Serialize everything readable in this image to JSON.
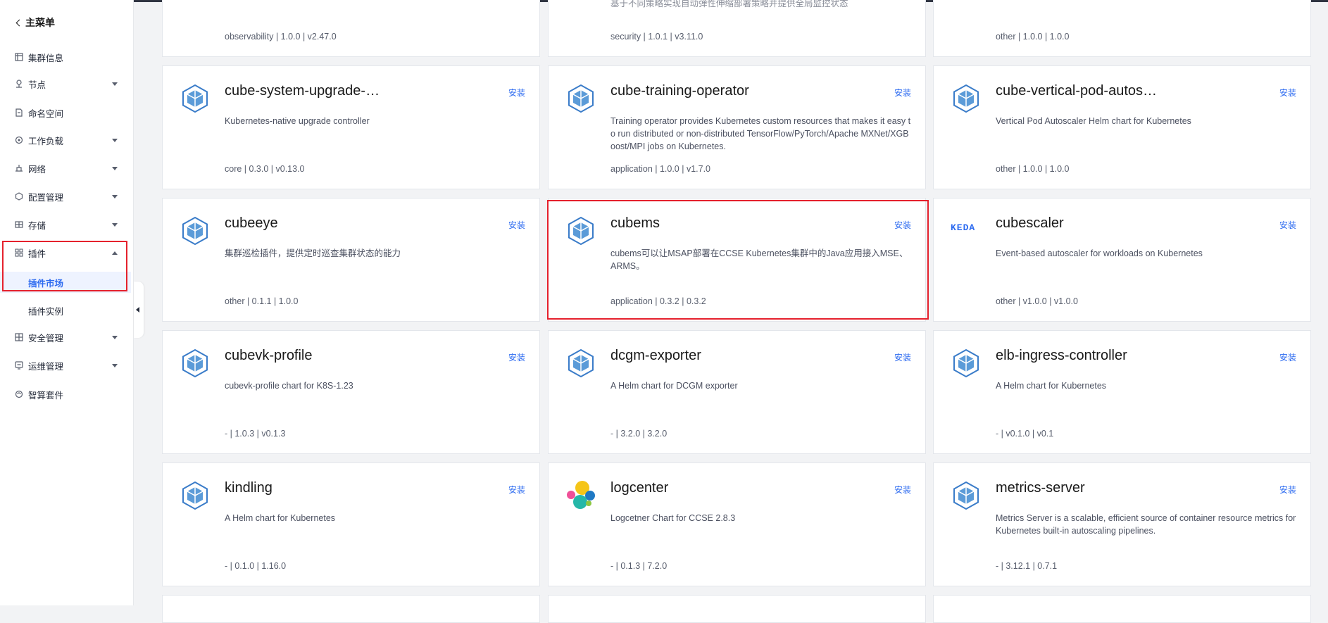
{
  "sidebar": {
    "back_label": "主菜单",
    "items": [
      {
        "label": "集群信息",
        "icon": "grid-icon"
      },
      {
        "label": "节点",
        "icon": "node-icon"
      },
      {
        "label": "命名空间",
        "icon": "namespace-icon"
      },
      {
        "label": "工作负载",
        "icon": "workload-icon"
      },
      {
        "label": "网络",
        "icon": "network-icon"
      },
      {
        "label": "配置管理",
        "icon": "config-icon"
      },
      {
        "label": "存储",
        "icon": "storage-icon"
      },
      {
        "label": "插件",
        "icon": "plugin-icon"
      },
      {
        "label": "安全管理",
        "icon": "security-icon"
      },
      {
        "label": "运维管理",
        "icon": "ops-icon"
      },
      {
        "label": "智算套件",
        "icon": "ai-suite-icon"
      }
    ],
    "plugin_sub": [
      "插件市场",
      "插件实例"
    ]
  },
  "cards": [
    {
      "name": "",
      "desc": "",
      "meta": "observability | 1.0.0 | v2.47.0",
      "install": ""
    },
    {
      "name": "",
      "desc": "基于不同策略实现自动弹性伸缩部署策略并提供全局监控状态",
      "meta": "security | 1.0.1 | v3.11.0",
      "install": ""
    },
    {
      "name": "",
      "desc": "",
      "meta": "other | 1.0.0 | 1.0.0",
      "install": ""
    },
    {
      "name": "cube-system-upgrade-…",
      "desc": "Kubernetes-native upgrade controller",
      "meta": "core | 0.3.0 | v0.13.0",
      "install": "安装"
    },
    {
      "name": "cube-training-operator",
      "desc": "Training operator provides Kubernetes custom resources that makes it easy to run distributed or non-distributed TensorFlow/PyTorch/Apache MXNet/XGBoost/MPI jobs on Kubernetes.",
      "meta": "application | 1.0.0 | v1.7.0",
      "install": "安装"
    },
    {
      "name": "cube-vertical-pod-autos…",
      "desc": "Vertical Pod Autoscaler Helm chart for Kubernetes",
      "meta": "other | 1.0.0 | 1.0.0",
      "install": "安装"
    },
    {
      "name": "cubeeye",
      "desc": "集群巡检插件，提供定时巡查集群状态的能力",
      "meta": "other | 0.1.1 | 1.0.0",
      "install": "安装"
    },
    {
      "name": "cubems",
      "desc": "cubems可以让MSAP部署在CCSE Kubernetes集群中的Java应用接入MSE、ARMS。",
      "meta": "application | 0.3.2 | 0.3.2",
      "install": "安装"
    },
    {
      "name": "cubescaler",
      "desc": "Event-based autoscaler for workloads on Kubernetes",
      "meta": "other | v1.0.0 | v1.0.0",
      "install": "安装",
      "logo_text": "KEDA"
    },
    {
      "name": "cubevk-profile",
      "desc": "cubevk-profile chart for K8S-1.23",
      "meta": "- | 1.0.3 | v0.1.3",
      "install": "安装"
    },
    {
      "name": "dcgm-exporter",
      "desc": "A Helm chart for DCGM exporter",
      "meta": "- | 3.2.0 | 3.2.0",
      "install": "安装"
    },
    {
      "name": "elb-ingress-controller",
      "desc": "A Helm chart for Kubernetes",
      "meta": "- | v0.1.0 | v0.1",
      "install": "安装"
    },
    {
      "name": "kindling",
      "desc": "A Helm chart for Kubernetes",
      "meta": "- | 0.1.0 | 1.16.0",
      "install": "安装"
    },
    {
      "name": "logcenter",
      "desc": "Logcetner Chart for CCSE 2.8.3",
      "meta": "- | 0.1.3 | 7.2.0",
      "install": "安装"
    },
    {
      "name": "metrics-server",
      "desc": "Metrics Server is a scalable, efficient source of container resource metrics for Kubernetes built-in autoscaling pipelines.",
      "meta": "- | 3.12.1 | 0.7.1",
      "install": "安装"
    }
  ],
  "colors": {
    "accent": "#2d6bf0",
    "highlight": "#e5212d"
  }
}
